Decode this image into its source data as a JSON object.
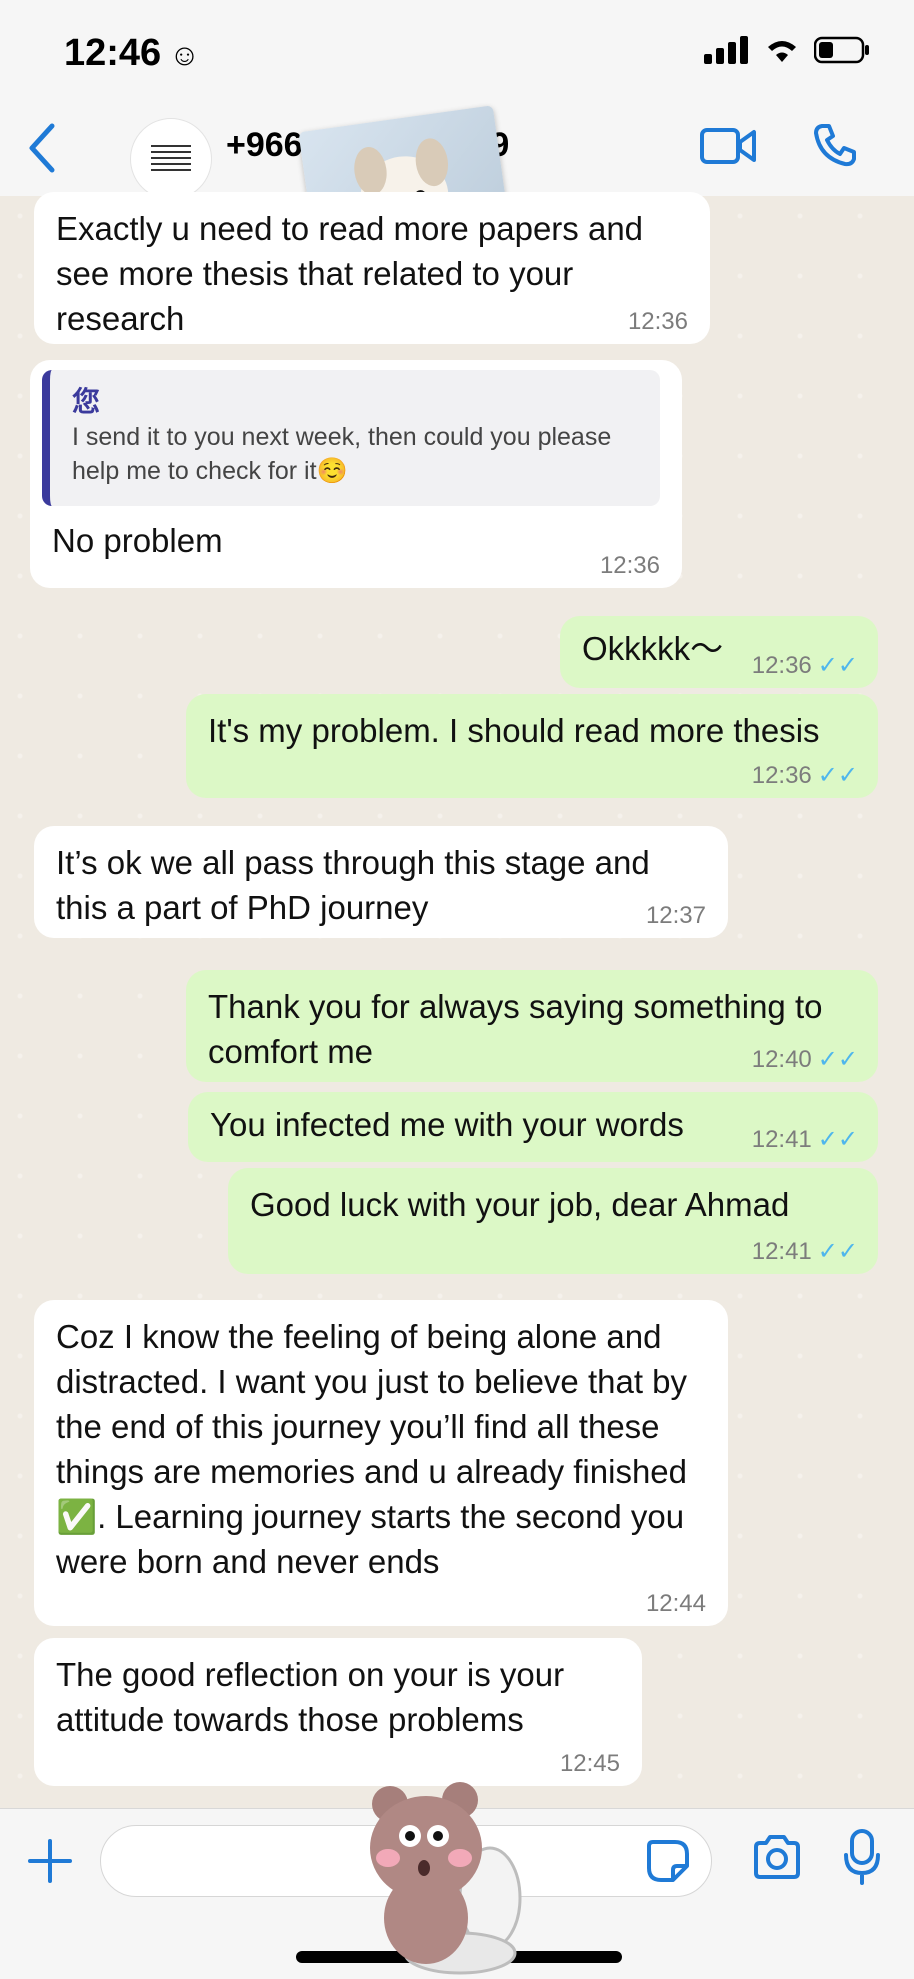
{
  "status_bar": {
    "time": "12:46",
    "time_icon": "smiley-icon",
    "icons": [
      "signal-icon",
      "wifi-icon",
      "battery-icon"
    ]
  },
  "header": {
    "contact": "+966 5",
    "contact_suffix": "9",
    "back_icon": "chevron-left-icon",
    "video_icon": "video-call-icon",
    "call_icon": "phone-icon"
  },
  "colors": {
    "accent": "#1f7ad6",
    "incoming": "#ffffff",
    "outgoing": "#dcf8c6",
    "quote_bar": "#3b3a9c",
    "read_ticks": "#4fb6ec"
  },
  "messages": [
    {
      "dir": "in",
      "text": "Exactly u need to read more papers and see more thesis that related to your research",
      "time": "12:36"
    },
    {
      "dir": "in",
      "quote_author": "您",
      "quote_text": "I send it to you next week, then could you please help me to check for it☺️",
      "text": "No problem",
      "time": "12:36"
    },
    {
      "dir": "out",
      "text": "Okkkkk～",
      "time": "12:36",
      "ticks": "✓✓"
    },
    {
      "dir": "out",
      "text": "It's my problem. I should read more thesis",
      "time": "12:36",
      "ticks": "✓✓"
    },
    {
      "dir": "in",
      "text": "It’s ok we all pass through this stage and this a part of PhD journey",
      "time": "12:37"
    },
    {
      "dir": "out",
      "text": "Thank you for always saying something to comfort me",
      "time": "12:40",
      "ticks": "✓✓"
    },
    {
      "dir": "out",
      "text": "You infected me with your words",
      "time": "12:41",
      "ticks": "✓✓"
    },
    {
      "dir": "out",
      "text": "Good luck with your job, dear Ahmad",
      "time": "12:41",
      "ticks": "✓✓"
    },
    {
      "dir": "in",
      "text": "Coz I know the feeling of being alone and distracted. I want you just to believe that by the end of this journey you’ll find all these things are memories and u already finished ✅. Learning journey starts the second you were born and never ends",
      "time": "12:44"
    },
    {
      "dir": "in",
      "text": "The good reflection on your is your attitude towards those problems",
      "time": "12:45"
    }
  ],
  "composer": {
    "plus_icon": "plus-icon",
    "sticker_icon": "sticker-icon",
    "camera_icon": "camera-icon",
    "mic_icon": "microphone-icon",
    "placeholder": ""
  }
}
